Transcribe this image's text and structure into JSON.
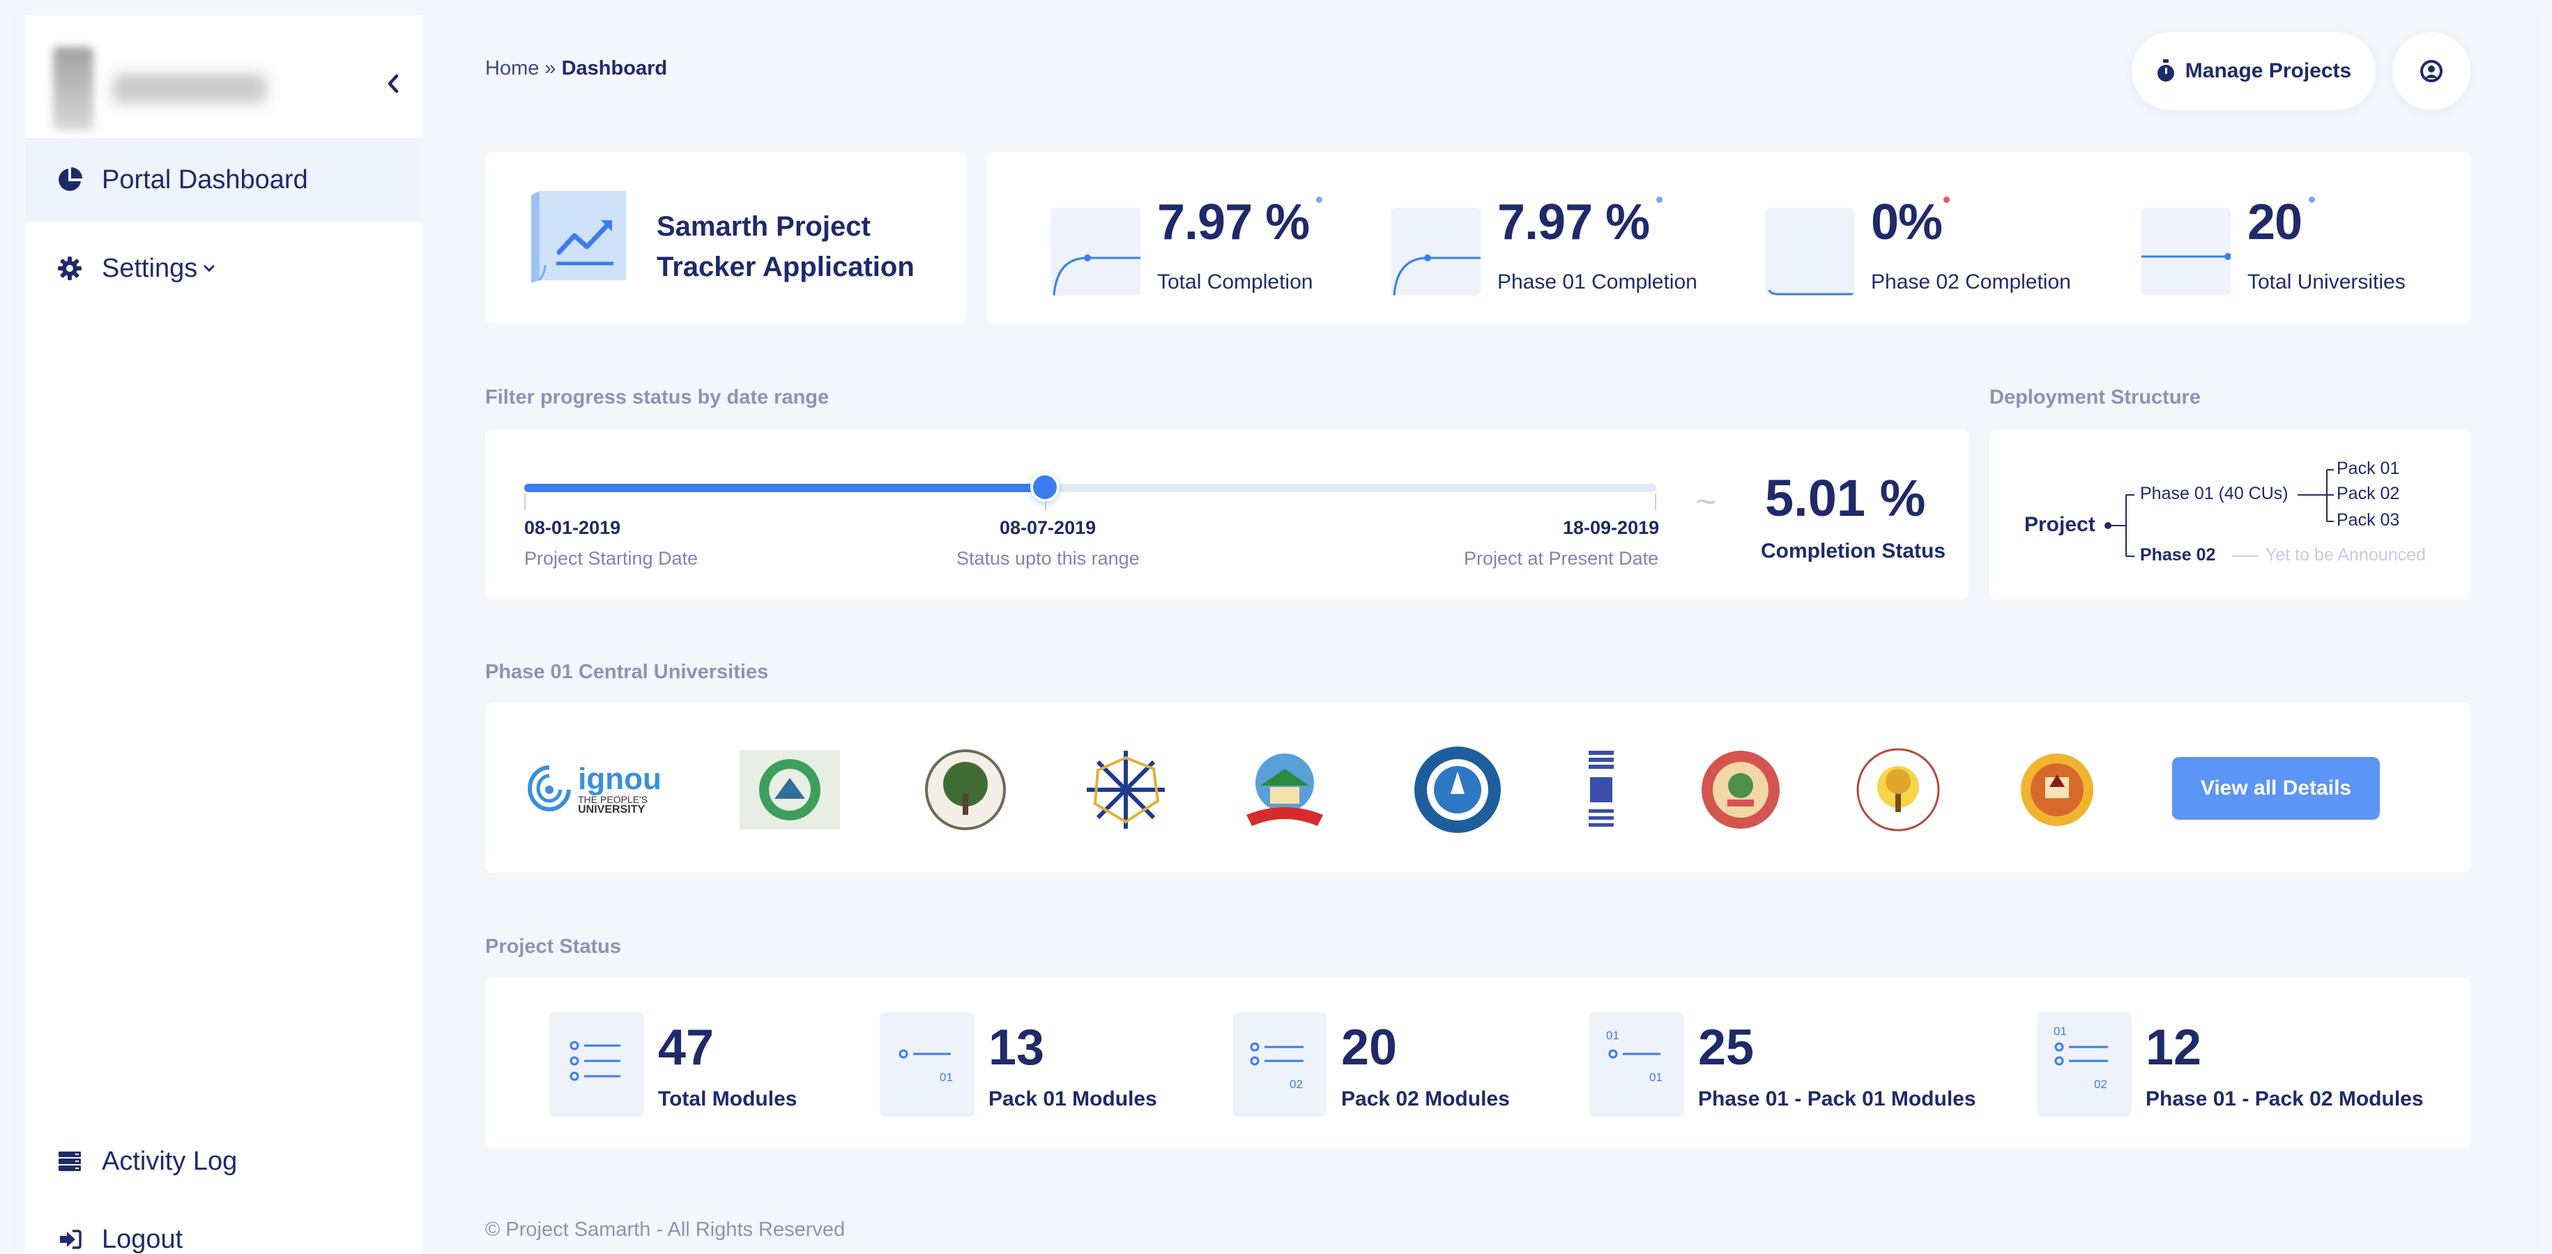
{
  "sidebar": {
    "items": [
      {
        "label": "Portal Dashboard"
      },
      {
        "label": "Settings"
      },
      {
        "label": "Activity Log"
      },
      {
        "label": "Logout"
      }
    ]
  },
  "header": {
    "breadcrumb_home": "Home",
    "breadcrumb_sep": " » ",
    "breadcrumb_current": "Dashboard",
    "manage_label": "Manage Projects"
  },
  "app": {
    "title": "Samarth Project Tracker Application"
  },
  "stats": [
    {
      "value": "7.97 %",
      "label": "Total Completion",
      "dot_color": "#7aa6f5"
    },
    {
      "value": "7.97 %",
      "label": "Phase 01 Completion",
      "dot_color": "#7aa6f5"
    },
    {
      "value": "0%",
      "label": "Phase 02 Completion",
      "dot_color": "#e8546b"
    },
    {
      "value": "20",
      "label": "Total Universities",
      "dot_color": "#7aa6f5"
    }
  ],
  "filter": {
    "section_title": "Filter progress status by date range",
    "start_date": "08-01-2019",
    "start_caption": "Project Starting Date",
    "mid_date": "08-07-2019",
    "mid_caption": "Status upto this range",
    "end_date": "18-09-2019",
    "end_caption": "Project at Present Date",
    "tilde": "~",
    "completion_value": "5.01 %",
    "completion_label": "Completion Status"
  },
  "deployment": {
    "section_title": "Deployment Structure",
    "root": "Project",
    "phase1": "Phase 01 (40 CUs)",
    "packs": [
      "Pack 01",
      "Pack 02",
      "Pack 03"
    ],
    "phase2": "Phase 02",
    "phase2_note": "Yet to be Announced"
  },
  "universities": {
    "section_title": "Phase 01 Central Universities",
    "ignou_name": "ignou",
    "ignou_tag1": "THE PEOPLE'S",
    "ignou_tag2": "UNIVERSITY",
    "view_all_label": "View all Details"
  },
  "project_status": {
    "section_title": "Project Status",
    "modules": [
      {
        "value": "47",
        "label": "Total Modules"
      },
      {
        "value": "13",
        "label": "Pack 01 Modules",
        "tag": "01"
      },
      {
        "value": "20",
        "label": "Pack 02 Modules",
        "tag": "02"
      },
      {
        "value": "25",
        "label": "Phase 01 - Pack 01 Modules",
        "tag_top": "01",
        "tag": "01"
      },
      {
        "value": "12",
        "label": "Phase 01 - Pack 02 Modules",
        "tag_top": "01",
        "tag": "02"
      }
    ]
  },
  "footer": {
    "text": "© Project Samarth - All Rights Reserved"
  },
  "colors": {
    "accent": "#3b7ded",
    "navy": "#1f2a6b",
    "button": "#5b95f5"
  }
}
